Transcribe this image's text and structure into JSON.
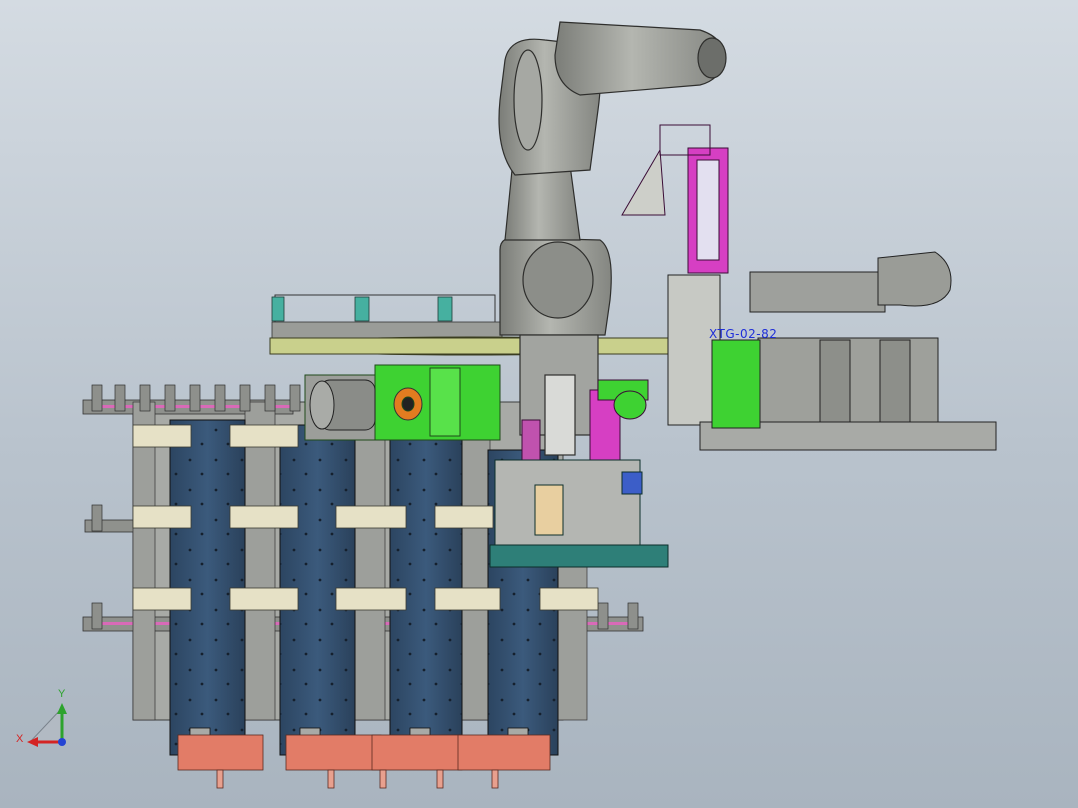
{
  "view": {
    "annotation_text": "XTG-02-82",
    "axis_x_label": "X",
    "axis_y_label": "Y"
  },
  "colors": {
    "background_top": "#d4dbe2",
    "background_bottom": "#a9b4bf",
    "robot_gray": "#9a9c96",
    "tray_blue": "#34506e",
    "frame_gray": "#a8aaa6",
    "clamp_cream": "#e6e1c6",
    "motor_salmon": "#e27c67",
    "drive_green": "#3ed232",
    "plate_olive": "#c9d08c",
    "slide_magenta": "#d63fc3",
    "base_teal": "#2e7f78",
    "annotation_blue": "#1f2fd8"
  },
  "parts": [
    "six-axis-robot-arm",
    "turntable-plate",
    "green-gear-drive",
    "servo-motor",
    "linear-module",
    "vertical-slide-assembly",
    "tray-stacks",
    "stepper-motors",
    "teal-base-plate"
  ]
}
